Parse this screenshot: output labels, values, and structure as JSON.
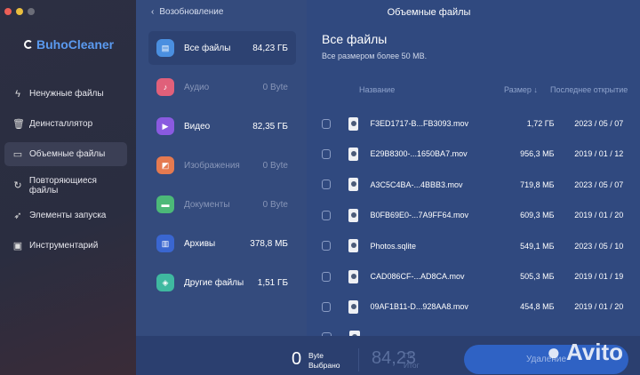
{
  "app": {
    "name": "BuhoCleaner",
    "traffic_lights": [
      "#ec5f57",
      "#e9be3e",
      "#6b6d78"
    ]
  },
  "sidebar": {
    "items": [
      {
        "label": "Ненужные файлы",
        "icon": "lightning-icon",
        "glyph": "ϟ"
      },
      {
        "label": "Деинсталлятор",
        "icon": "trash-icon",
        "glyph": "🗑"
      },
      {
        "label": "Объемные файлы",
        "icon": "folder-icon",
        "glyph": "▭",
        "active": true
      },
      {
        "label": "Повторяющиеся файлы",
        "icon": "refresh-icon",
        "glyph": "↻"
      },
      {
        "label": "Элементы запуска",
        "icon": "rocket-icon",
        "glyph": "➶"
      },
      {
        "label": "Инструментарий",
        "icon": "toolbox-icon",
        "glyph": "▣"
      }
    ]
  },
  "back_label": "Возобновление",
  "page_title": "Объемные файлы",
  "categories": [
    {
      "label": "Все файлы",
      "size": "84,23 ГБ",
      "color": "#4a8fe0",
      "glyph": "▤",
      "active": true
    },
    {
      "label": "Аудио",
      "size": "0 Byte",
      "color": "#e0607a",
      "glyph": "♪",
      "dim": true
    },
    {
      "label": "Видео",
      "size": "82,35 ГБ",
      "color": "#8a5ae0",
      "glyph": "▶"
    },
    {
      "label": "Изображения",
      "size": "0 Byte",
      "color": "#e57a50",
      "glyph": "◩",
      "dim": true
    },
    {
      "label": "Документы",
      "size": "0 Byte",
      "color": "#4cb978",
      "glyph": "▬",
      "dim": true
    },
    {
      "label": "Архивы",
      "size": "378,8 МБ",
      "color": "#3a66d0",
      "glyph": "▥"
    },
    {
      "label": "Другие файлы",
      "size": "1,51 ГБ",
      "color": "#3fb9a0",
      "glyph": "◈"
    }
  ],
  "main": {
    "title": "Все файлы",
    "subtitle": "Все размером более 50 МВ.",
    "columns": {
      "name": "Название",
      "size": "Размер ↓",
      "date": "Последнее открытие"
    },
    "rows": [
      {
        "name": "F3ED1717-B...FB3093.mov",
        "size": "1,72 ГБ",
        "date": "2023 / 05 / 07"
      },
      {
        "name": "E29B8300-...1650BA7.mov",
        "size": "956,3 МБ",
        "date": "2019 / 01 / 12"
      },
      {
        "name": "A3C5C4BA-...4BBB3.mov",
        "size": "719,8 МБ",
        "date": "2023 / 05 / 07"
      },
      {
        "name": "B0FB69E0-...7A9FF64.mov",
        "size": "609,3 МБ",
        "date": "2019 / 01 / 20"
      },
      {
        "name": "Photos.sqlite",
        "size": "549,1 МБ",
        "date": "2023 / 05 / 10"
      },
      {
        "name": "CAD086CF-...AD8CA.mov",
        "size": "505,3 МБ",
        "date": "2019 / 01 / 19"
      },
      {
        "name": "09AF1B11-D...928AA8.mov",
        "size": "454,8 МБ",
        "date": "2019 / 01 / 20"
      }
    ]
  },
  "footer": {
    "selected_value": "0",
    "selected_unit": "Byte",
    "selected_label": "Выбрано",
    "total_value": "84,23",
    "total_unit": "ГБ",
    "total_label": "Итог",
    "delete_label": "Удаление"
  },
  "watermark": "Avito"
}
